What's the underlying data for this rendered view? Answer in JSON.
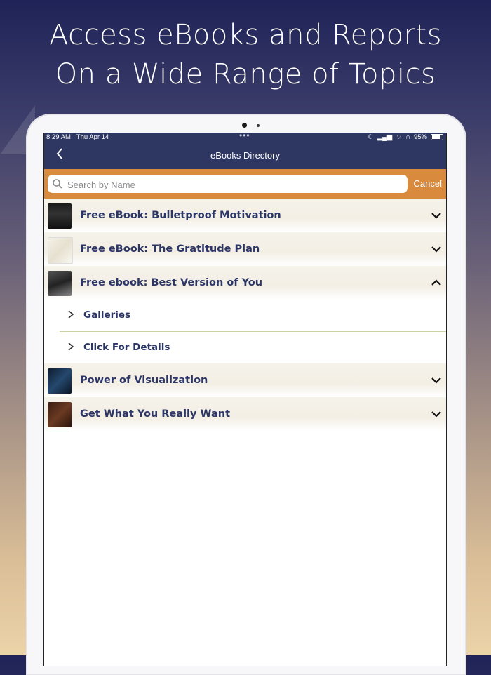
{
  "headline": {
    "line1": "Access eBooks and Reports",
    "line2": "On a Wide Range of Topics"
  },
  "status_bar": {
    "time": "8:29 AM",
    "date": "Thu Apr 14",
    "battery": "95%",
    "multitask_dots": "•••"
  },
  "nav": {
    "back_icon": "chevron-left-icon",
    "title": "eBooks Directory"
  },
  "search": {
    "placeholder": "Search by Name",
    "value": "",
    "cancel_label": "Cancel"
  },
  "colors": {
    "navbar": "#2e3762",
    "search_bar": "#d98a3d",
    "label_text": "#2c3666"
  },
  "ebooks": [
    {
      "title": "Free eBook: Bulletproof Motivation",
      "expanded": false,
      "thumb": "book-cover-icon"
    },
    {
      "title": "Free eBook: The Gratitude Plan",
      "expanded": false,
      "thumb": "book-cover-icon"
    },
    {
      "title": "Free ebook: Best Version of You",
      "expanded": true,
      "thumb": "book-cover-icon",
      "children": [
        {
          "label": "Galleries"
        },
        {
          "label": "Click For Details"
        }
      ]
    },
    {
      "title": "Power of Visualization",
      "expanded": false,
      "thumb": "book-cover-icon"
    },
    {
      "title": "Get What You Really Want",
      "expanded": false,
      "thumb": "book-cover-icon"
    }
  ]
}
